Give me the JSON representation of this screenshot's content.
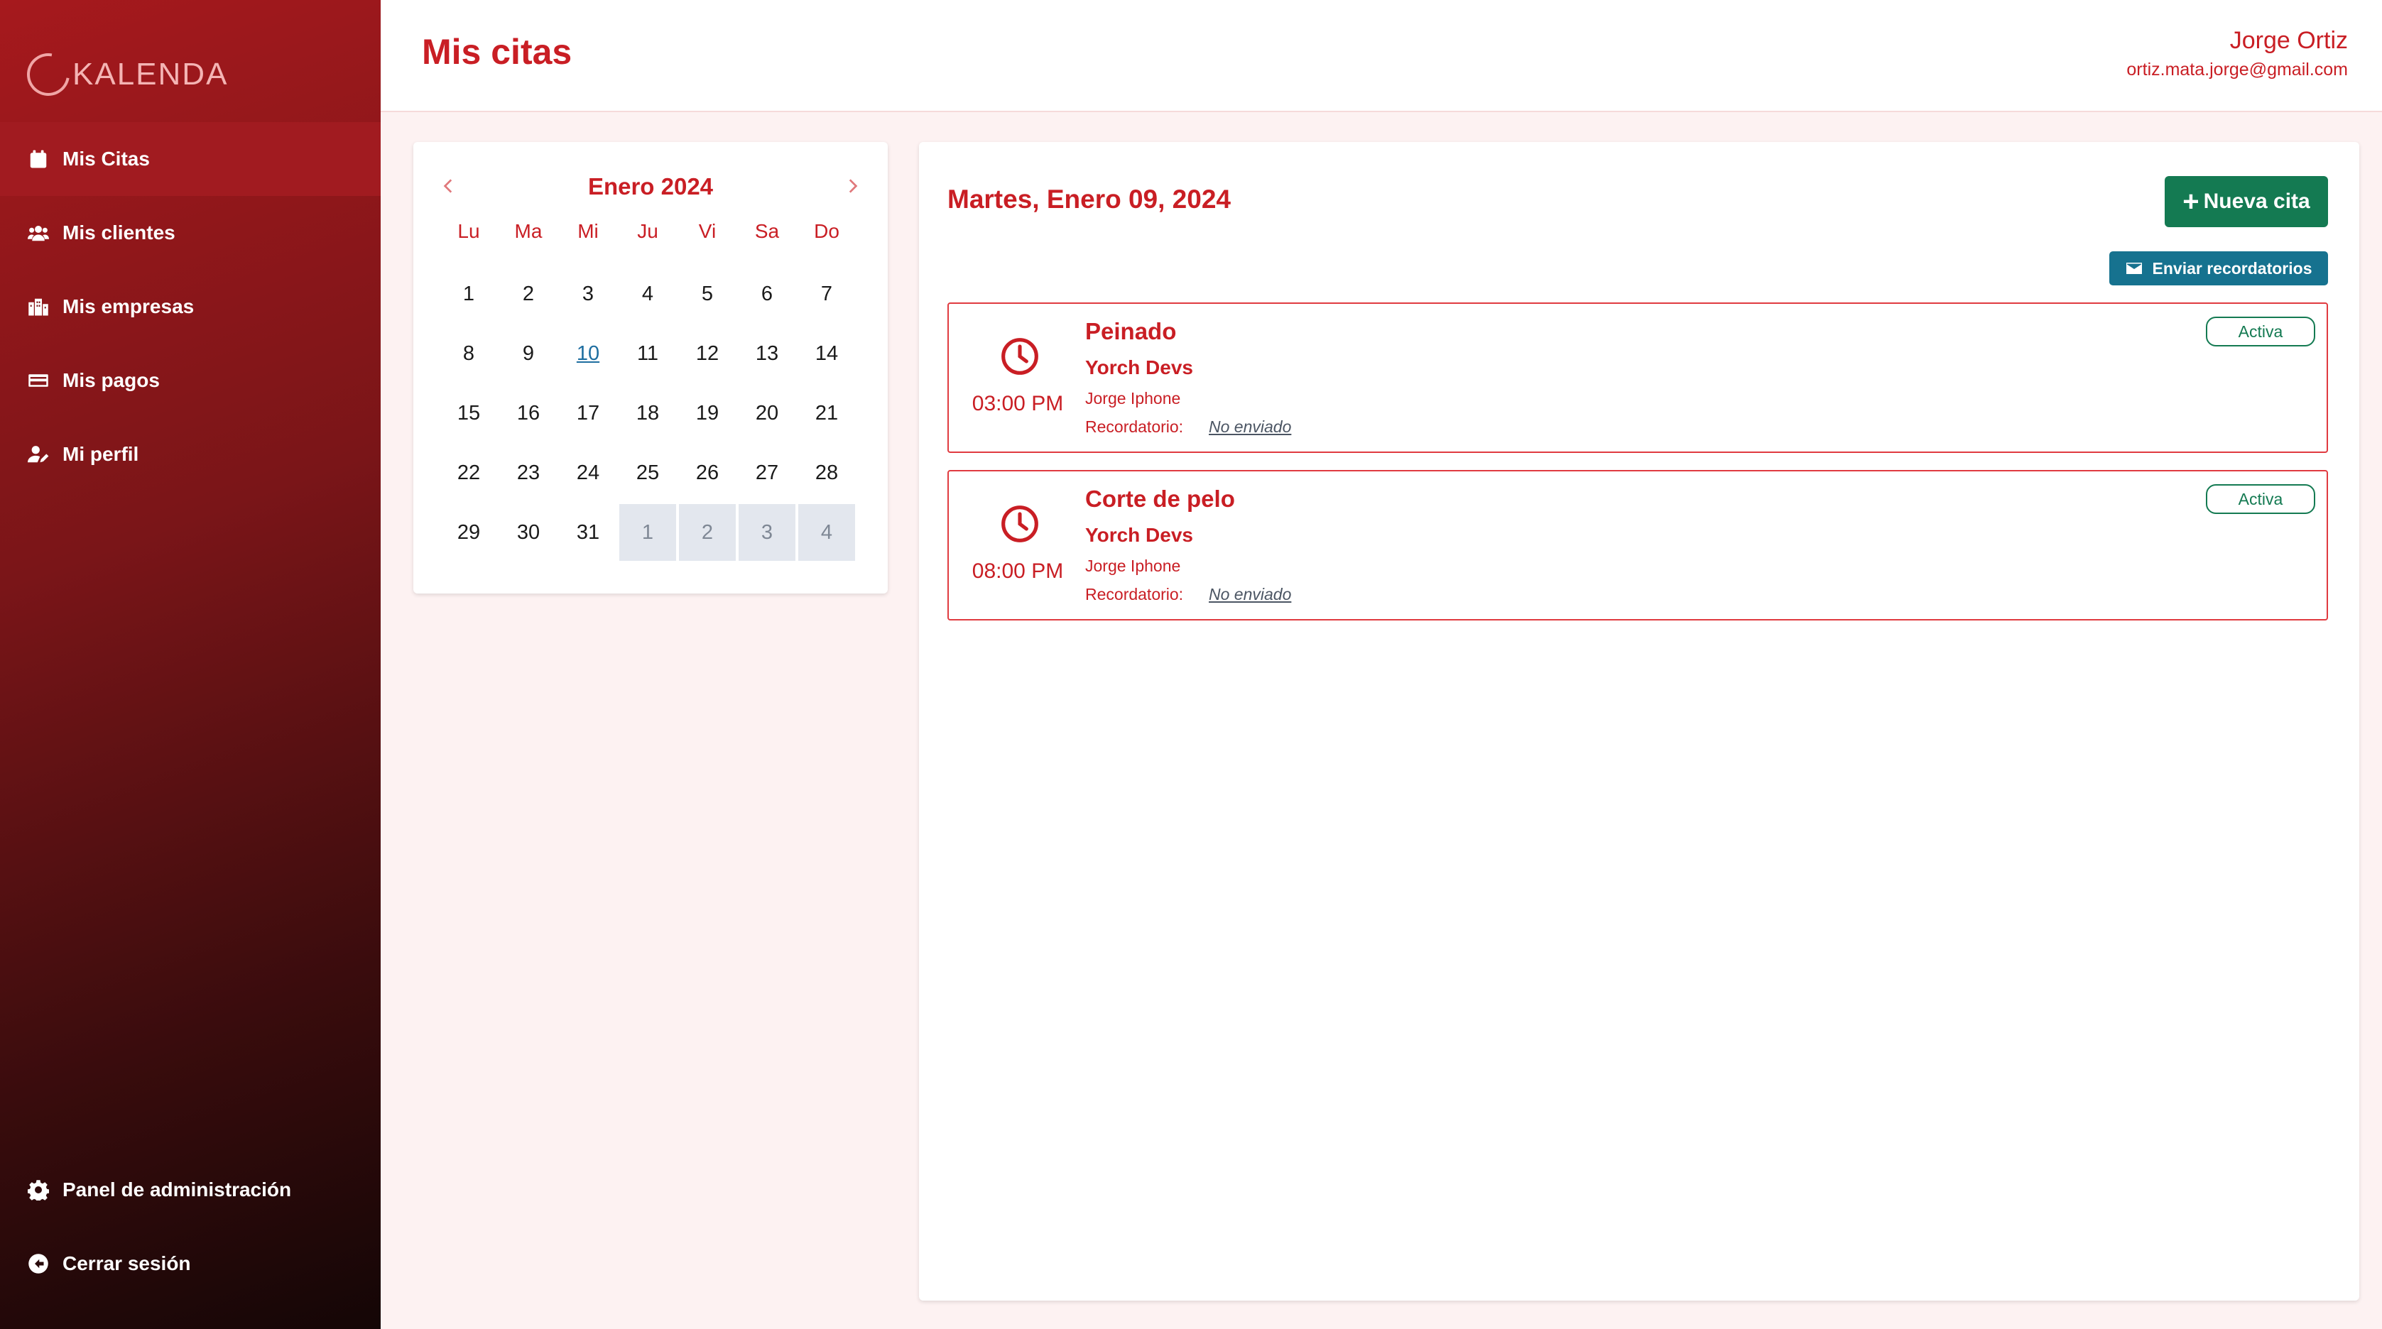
{
  "app": {
    "logo_text": "KALENDA"
  },
  "sidebar": {
    "items": [
      {
        "label": "Mis Citas",
        "icon": "calendar-icon",
        "active": true
      },
      {
        "label": "Mis clientes",
        "icon": "users-icon",
        "active": false
      },
      {
        "label": "Mis empresas",
        "icon": "building-icon",
        "active": false
      },
      {
        "label": "Mis pagos",
        "icon": "credit-card-icon",
        "active": false
      },
      {
        "label": "Mi perfil",
        "icon": "user-edit-icon",
        "active": false
      }
    ],
    "bottom_items": [
      {
        "label": "Panel de administración",
        "icon": "gear-icon"
      },
      {
        "label": "Cerrar sesión",
        "icon": "logout-icon"
      }
    ]
  },
  "header": {
    "title": "Mis citas",
    "user_name": "Jorge Ortiz",
    "user_email": "ortiz.mata.jorge@gmail.com"
  },
  "calendar": {
    "month_label": "Enero 2024",
    "prev_icon": "chevron-left-icon",
    "next_icon": "chevron-right-icon",
    "weekdays": [
      "Lu",
      "Ma",
      "Mi",
      "Ju",
      "Vi",
      "Sa",
      "Do"
    ],
    "weeks": [
      [
        "1",
        "2",
        "3",
        "4",
        "5",
        "6",
        "7"
      ],
      [
        "8",
        "9",
        "10",
        "11",
        "12",
        "13",
        "14"
      ],
      [
        "15",
        "16",
        "17",
        "18",
        "19",
        "20",
        "21"
      ],
      [
        "22",
        "23",
        "24",
        "25",
        "26",
        "27",
        "28"
      ],
      [
        "29",
        "30",
        "31",
        "1",
        "2",
        "3",
        "4"
      ]
    ],
    "today": "10",
    "other_month_count": 4
  },
  "appointments_panel": {
    "date_title": "Martes, Enero 09, 2024",
    "new_button_label": "Nueva cita",
    "remind_button_label": "Enviar recordatorios",
    "reminder_label": "Recordatorio:",
    "items": [
      {
        "title": "Peinado",
        "company": "Yorch Devs",
        "client": "Jorge Iphone",
        "time": "03:00 PM",
        "reminder": "No enviado",
        "status": "Activa"
      },
      {
        "title": "Corte de pelo",
        "company": "Yorch Devs",
        "client": "Jorge Iphone",
        "time": "08:00 PM",
        "reminder": "No enviado",
        "status": "Activa"
      }
    ]
  },
  "colors": {
    "brand_red": "#c91e24",
    "success_green": "#147a52",
    "info_blue": "#16728f",
    "page_bg": "#fdf2f2"
  }
}
